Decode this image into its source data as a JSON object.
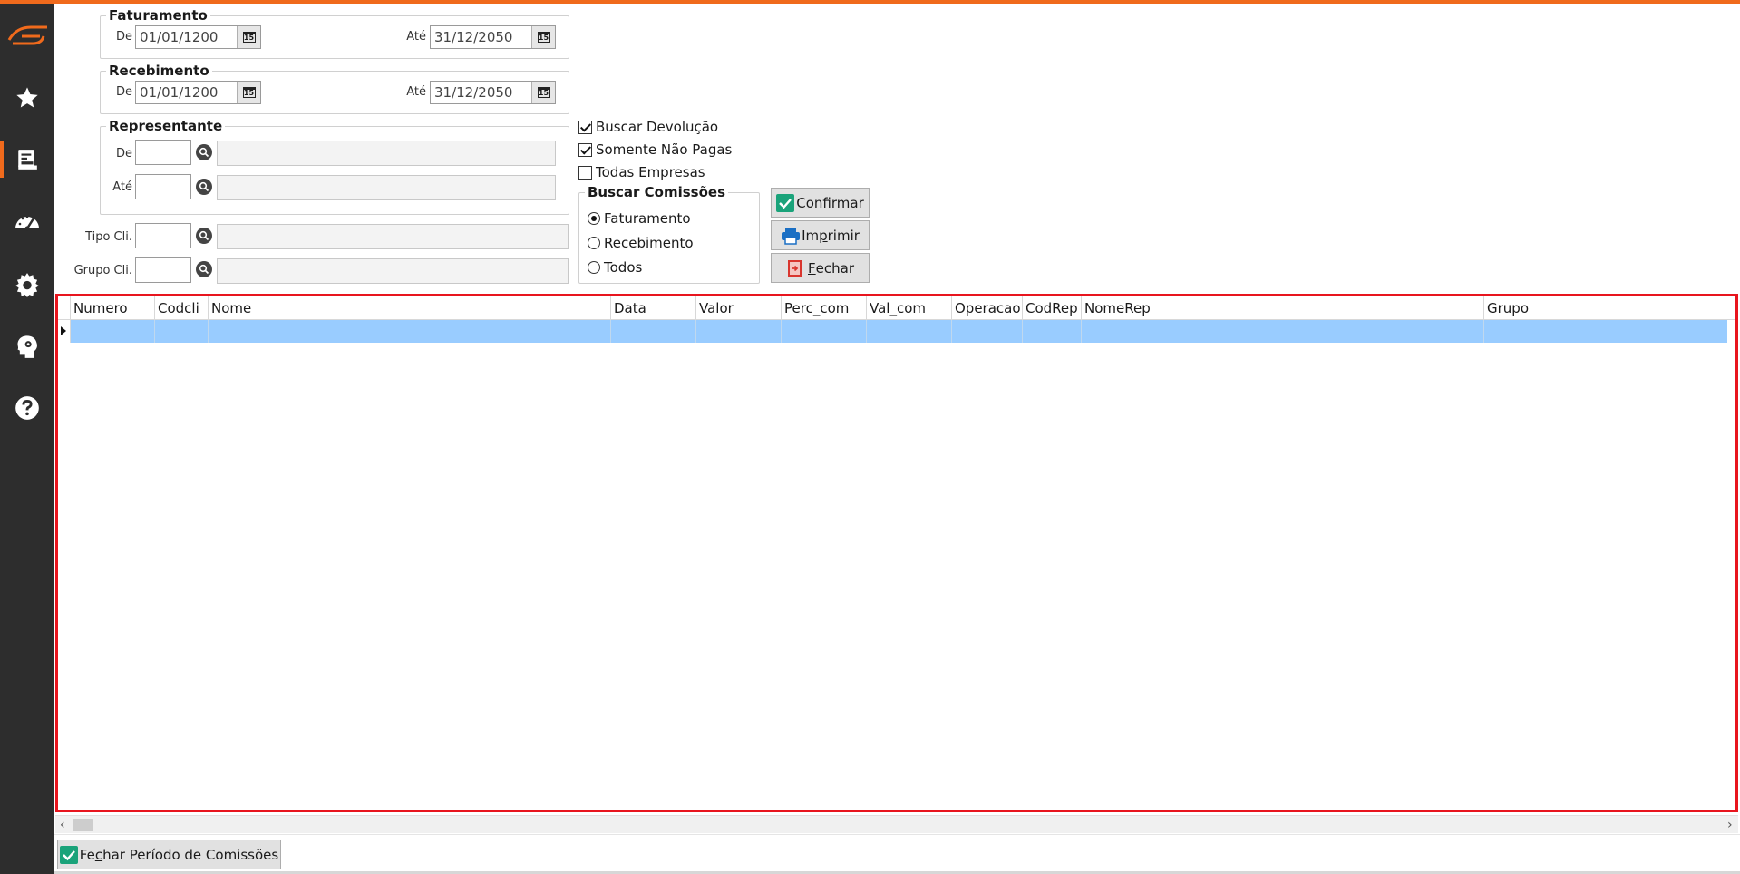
{
  "sidebar": {
    "items": [
      {
        "name": "logo-icon"
      },
      {
        "name": "star-icon"
      },
      {
        "name": "report-icon",
        "active": true
      },
      {
        "name": "gauge-icon"
      },
      {
        "name": "gear-icon"
      },
      {
        "name": "brain-icon"
      },
      {
        "name": "help-icon"
      }
    ]
  },
  "colors": {
    "accent": "#f06a1c",
    "sidebar": "#2d2d2d",
    "selected_row": "#99ccff",
    "highlight_border": "#e8151e",
    "check_green": "#1aa37a"
  },
  "faturamento": {
    "legend": "Faturamento",
    "de_label": "De",
    "de_value": "01/01/1200",
    "ate_label": "Até",
    "ate_value": "31/12/2050"
  },
  "recebimento": {
    "legend": "Recebimento",
    "de_label": "De",
    "de_value": "01/01/1200",
    "ate_label": "Até",
    "ate_value": "31/12/2050"
  },
  "representante": {
    "legend": "Representante",
    "de_label": "De",
    "ate_label": "Até"
  },
  "tipo_cli": {
    "label": "Tipo Cli."
  },
  "grupo_cli": {
    "label": "Grupo Cli."
  },
  "calendar_glyph": "15",
  "options": {
    "buscar_devolucao": {
      "label": "Buscar Devolução",
      "checked": true
    },
    "somente_nao_pagas": {
      "label": "Somente Não Pagas",
      "checked": true
    },
    "todas_empresas": {
      "label": "Todas Empresas",
      "checked": false
    }
  },
  "buscar_comissoes": {
    "legend": "Buscar Comissões",
    "options": [
      {
        "label": "Faturamento",
        "checked": true
      },
      {
        "label": "Recebimento",
        "checked": false
      },
      {
        "label": "Todos",
        "checked": false
      }
    ]
  },
  "buttons": {
    "confirmar": {
      "mnemonic": "C",
      "rest": "onfirmar"
    },
    "imprimir": {
      "pre": "Im",
      "mnemonic": "p",
      "rest": "rimir"
    },
    "fechar": {
      "mnemonic": "F",
      "rest": "echar"
    },
    "fechar_periodo": {
      "pre": "Fe",
      "mnemonic": "c",
      "rest": "har Período de Comissões"
    }
  },
  "grid": {
    "columns": [
      "Numero",
      "Codcli",
      "Nome",
      "Data",
      "Valor",
      "Perc_com",
      "Val_com",
      "Operacao",
      "CodRep",
      "NomeRep",
      "Grupo"
    ],
    "rows": [
      [
        "",
        "",
        "",
        "",
        "",
        "",
        "",
        "",
        "",
        "",
        ""
      ]
    ]
  }
}
